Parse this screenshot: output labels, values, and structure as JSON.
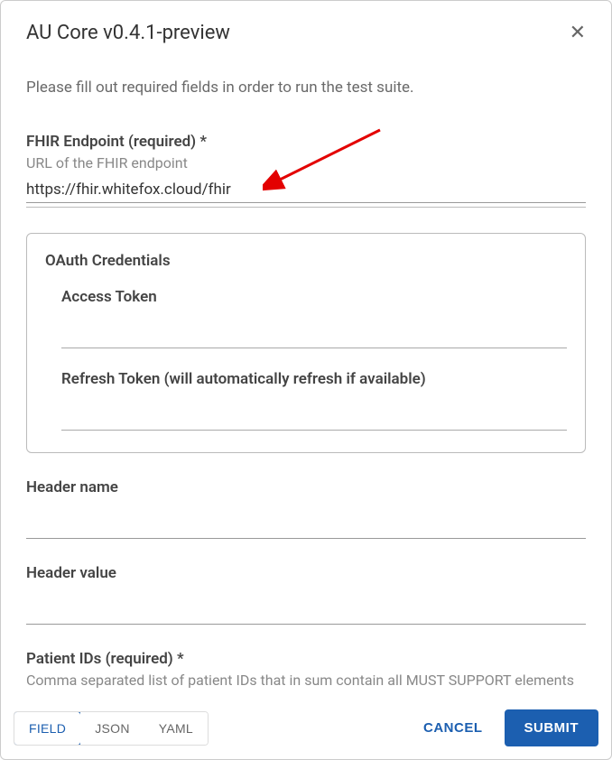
{
  "dialog": {
    "title": "AU Core v0.4.1-preview",
    "intro": "Please fill out required fields in order to run the test suite."
  },
  "fields": {
    "fhir_endpoint": {
      "label": "FHIR Endpoint (required) *",
      "help": "URL of the FHIR endpoint",
      "value": "https://fhir.whitefox.cloud/fhir"
    },
    "oauth": {
      "legend": "OAuth Credentials",
      "access_token": {
        "label": "Access Token",
        "value": ""
      },
      "refresh_token": {
        "label": "Refresh Token (will automatically refresh if available)",
        "value": ""
      }
    },
    "header_name": {
      "label": "Header name",
      "value": ""
    },
    "header_value": {
      "label": "Header value",
      "value": ""
    },
    "patient_ids": {
      "label": "Patient IDs (required) *",
      "help": "Comma separated list of patient IDs that in sum contain all MUST SUPPORT elements",
      "value": ""
    }
  },
  "tabs": {
    "field": "FIELD",
    "json": "JSON",
    "yaml": "YAML"
  },
  "actions": {
    "cancel": "CANCEL",
    "submit": "SUBMIT"
  }
}
